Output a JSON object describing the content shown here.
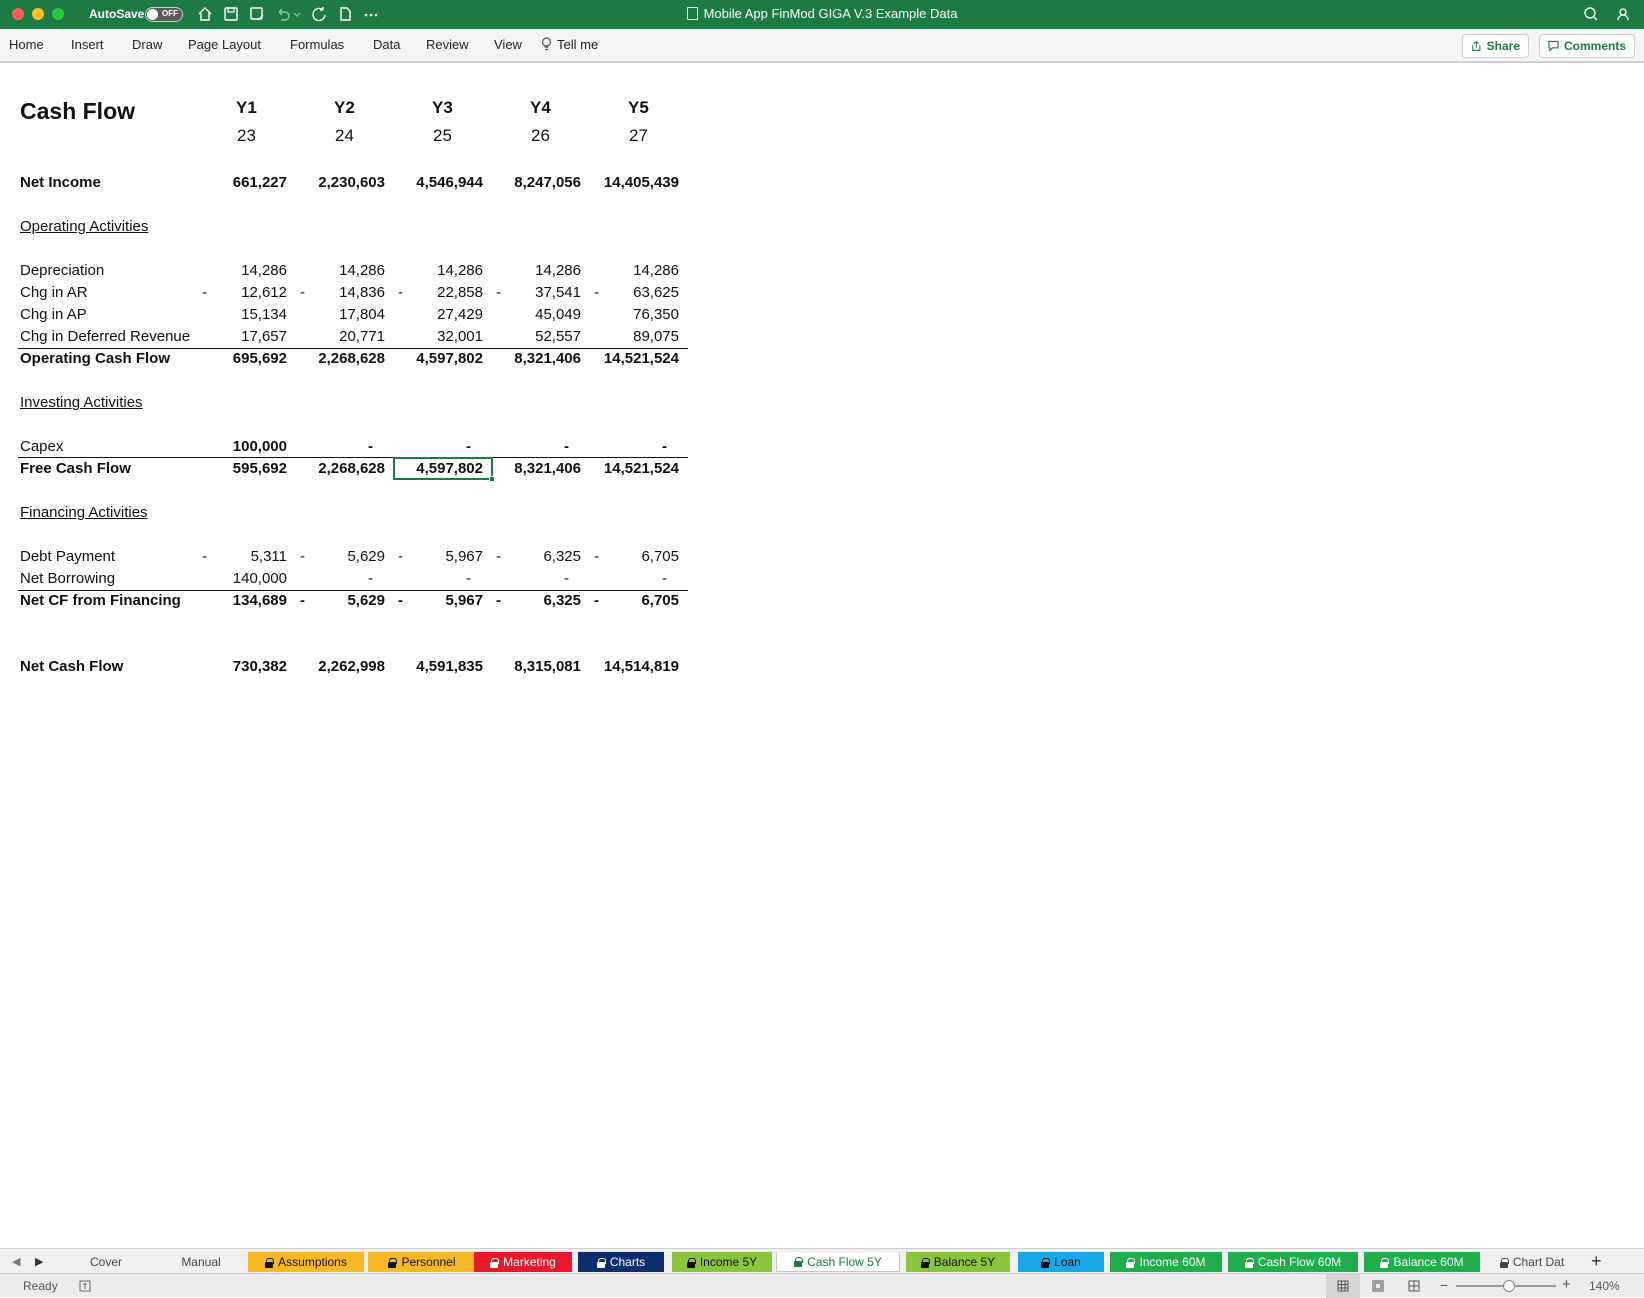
{
  "app": {
    "title": "Mobile App FinMod GIGA V.3 Example Data",
    "autosave_label": "AutoSave",
    "autosave_state": "OFF"
  },
  "ribbon": {
    "tabs": [
      "Home",
      "Insert",
      "Draw",
      "Page Layout",
      "Formulas",
      "Data",
      "Review",
      "View"
    ],
    "tell_me": "Tell me",
    "share": "Share",
    "comments": "Comments"
  },
  "sheet": {
    "title": "Cash Flow",
    "years": [
      "Y1",
      "Y2",
      "Y3",
      "Y4",
      "Y5"
    ],
    "year_numbers": [
      "23",
      "24",
      "25",
      "26",
      "27"
    ],
    "rows": {
      "net_income": {
        "label": "Net Income",
        "values": [
          "661,227",
          "2,230,603",
          "4,546,944",
          "8,247,056",
          "14,405,439"
        ]
      },
      "operating_header": "Operating Activities",
      "depreciation": {
        "label": "Depreciation",
        "values": [
          "14,286",
          "14,286",
          "14,286",
          "14,286",
          "14,286"
        ]
      },
      "chg_ar": {
        "label": "Chg in AR",
        "values": [
          "12,612",
          "14,836",
          "22,858",
          "37,541",
          "63,625"
        ]
      },
      "chg_ap": {
        "label": "Chg in AP",
        "values": [
          "15,134",
          "17,804",
          "27,429",
          "45,049",
          "76,350"
        ]
      },
      "chg_deferred": {
        "label": "Chg in Deferred Revenue",
        "values": [
          "17,657",
          "20,771",
          "32,001",
          "52,557",
          "89,075"
        ]
      },
      "operating_cf": {
        "label": "Operating Cash Flow",
        "values": [
          "695,692",
          "2,268,628",
          "4,597,802",
          "8,321,406",
          "14,521,524"
        ]
      },
      "investing_header": "Investing Activities",
      "capex": {
        "label": "Capex",
        "values": [
          "100,000",
          "-",
          "-",
          "-",
          "-"
        ]
      },
      "free_cf": {
        "label": "Free Cash Flow",
        "values": [
          "595,692",
          "2,268,628",
          "4,597,802",
          "8,321,406",
          "14,521,524"
        ]
      },
      "financing_header": "Financing Activities",
      "debt_payment": {
        "label": "Debt Payment",
        "values": [
          "5,311",
          "5,629",
          "5,967",
          "6,325",
          "6,705"
        ]
      },
      "net_borrowing": {
        "label": "Net Borrowing",
        "values": [
          "140,000",
          "-",
          "-",
          "-",
          "-"
        ]
      },
      "net_cf_financing": {
        "label": "Net CF from Financing",
        "values": [
          "134,689",
          "5,629",
          "5,967",
          "6,325",
          "6,705"
        ]
      },
      "net_cash_flow": {
        "label": "Net Cash Flow",
        "values": [
          "730,382",
          "2,262,998",
          "4,591,835",
          "8,315,081",
          "14,514,819"
        ]
      }
    },
    "negative_marker": "-"
  },
  "sheet_tabs": [
    {
      "label": "Cover",
      "bg": "#f0f0f0",
      "fg": "#444"
    },
    {
      "label": "Manual",
      "bg": "#f0f0f0",
      "fg": "#444"
    },
    {
      "label": "Assumptions",
      "bg": "#f7b928",
      "fg": "#111"
    },
    {
      "label": "Personnel",
      "bg": "#f7b928",
      "fg": "#111"
    },
    {
      "label": "Marketing",
      "bg": "#e8192c",
      "fg": "#fff"
    },
    {
      "label": "Charts",
      "bg": "#0d2e6e",
      "fg": "#fff"
    },
    {
      "label": "Income 5Y",
      "bg": "#8bc540",
      "fg": "#111"
    },
    {
      "label": "Cash Flow 5Y",
      "bg": "#ffffff",
      "fg": "#1e7a43"
    },
    {
      "label": "Balance 5Y",
      "bg": "#8bc540",
      "fg": "#111"
    },
    {
      "label": "Loan",
      "bg": "#1aa7e8",
      "fg": "#111"
    },
    {
      "label": "Income 60M",
      "bg": "#1fae4b",
      "fg": "#fff"
    },
    {
      "label": "Cash Flow 60M",
      "bg": "#1fae4b",
      "fg": "#fff"
    },
    {
      "label": "Balance 60M",
      "bg": "#1fae4b",
      "fg": "#fff"
    },
    {
      "label": "Chart Dat",
      "bg": "#f0f0f0",
      "fg": "#444"
    }
  ],
  "status": {
    "ready": "Ready",
    "zoom": "140%"
  },
  "colors": {
    "accent": "#1e7a43"
  }
}
